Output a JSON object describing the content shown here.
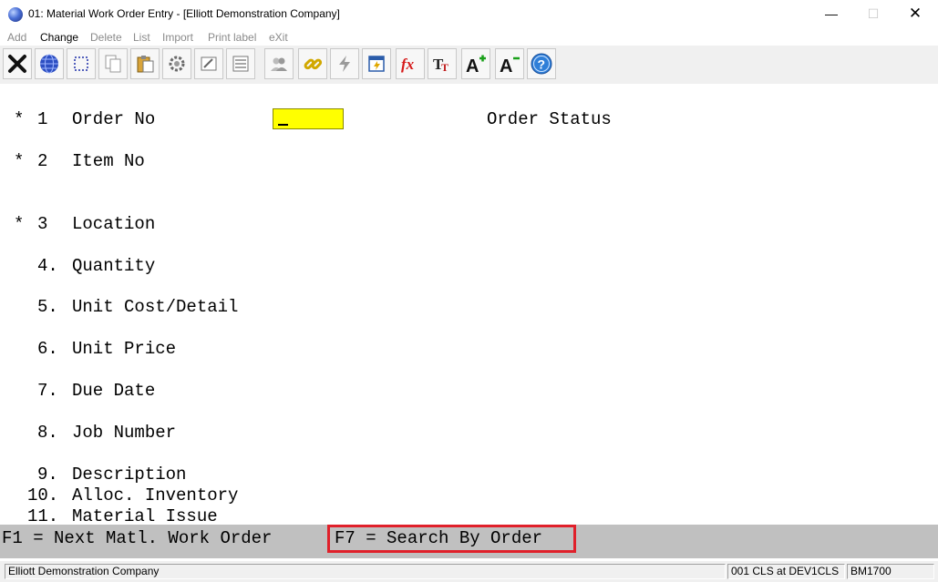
{
  "window": {
    "title": "01: Material Work Order Entry - [Elliott Demonstration Company]",
    "minimize": "—",
    "maximize": "☐",
    "close": "✕"
  },
  "menu": {
    "items": [
      {
        "label": "Add",
        "enabled": false
      },
      {
        "label": "Change",
        "enabled": true
      },
      {
        "label": "Delete",
        "enabled": false
      },
      {
        "label": "List",
        "enabled": false
      },
      {
        "label": "Import",
        "enabled": false
      },
      {
        "label": "Print label",
        "enabled": false
      },
      {
        "label": "eXit",
        "enabled": false
      }
    ]
  },
  "toolbar": {
    "buttons": [
      "exit-icon",
      "globe-icon",
      "select-icon",
      "copy-icon",
      "paste-icon",
      "settings-icon",
      "edit-form-icon",
      "list-icon",
      "users-icon",
      "link-icon",
      "lightning-icon",
      "notes-icon",
      "function-icon",
      "font-icon",
      "font-increase-icon",
      "font-decrease-icon",
      "help-icon"
    ]
  },
  "form": {
    "fields": [
      {
        "mark": "*",
        "num": "1",
        "label": "Order No"
      },
      {
        "mark": "*",
        "num": "2",
        "label": "Item No"
      },
      {
        "mark": "*",
        "num": "3",
        "label": "Location"
      },
      {
        "mark": "",
        "num": "4.",
        "label": "Quantity"
      },
      {
        "mark": "",
        "num": "5.",
        "label": "Unit Cost/Detail"
      },
      {
        "mark": "",
        "num": "6.",
        "label": "Unit Price"
      },
      {
        "mark": "",
        "num": "7.",
        "label": "Due Date"
      },
      {
        "mark": "",
        "num": "8.",
        "label": "Job Number"
      },
      {
        "mark": "",
        "num": "9.",
        "label": "Description"
      },
      {
        "mark": "",
        "num": "10.",
        "label": "Alloc. Inventory"
      },
      {
        "mark": "",
        "num": "11.",
        "label": "Material Issue"
      }
    ],
    "order_status_label": "Order Status",
    "order_no_value": ""
  },
  "fkeys": {
    "f1": "F1 = Next Matl. Work Order",
    "f7": "F7 = Search By Order"
  },
  "status": {
    "company": "Elliott Demonstration Company",
    "connection": "001 CLS at DEV1CLS",
    "program": "BM1700"
  },
  "colors": {
    "input_highlight": "#ffff00",
    "f7_highlight_border": "#e0202a",
    "fkey_bar": "#c0c0c0"
  }
}
